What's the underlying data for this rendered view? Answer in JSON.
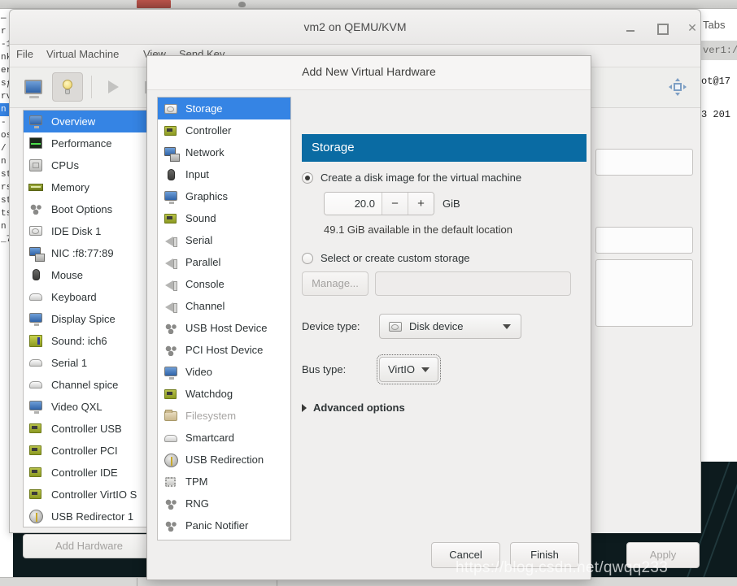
{
  "desktop": {
    "left_terminal_lines": [
      "—",
      "r",
      "-1",
      "nk",
      "er",
      "",
      "sƒ",
      "",
      "rv",
      "n",
      "-",
      "os",
      "/",
      "n",
      "st",
      "rs",
      "st",
      "ts",
      "n",
      "_7"
    ],
    "left_selected_index": 9,
    "right_terminal": {
      "tabs_label": "Tabs",
      "tab_title": "ver1:/..",
      "prompt_line": "ot@17",
      "date_line": "3 201"
    },
    "watermark": "https://blog.csdn.net/qwqq233"
  },
  "vm_window": {
    "title": "vm2 on QEMU/KVM",
    "window_buttons": {
      "minimize": "minimize-icon",
      "maximize": "maximize-icon",
      "close": "✕"
    },
    "menu": [
      "File",
      "Virtual Machine",
      "View",
      "Send Key"
    ],
    "toolbar": [
      {
        "name": "show-console-button",
        "icon": "monitor-icon"
      },
      {
        "name": "show-hardware-details-button",
        "icon": "lightbulb-icon",
        "active": true
      },
      {
        "name": "run-button",
        "icon": "play-icon"
      },
      {
        "name": "pause-button",
        "icon": "pause-icon"
      },
      {
        "name": "fullscreen-button",
        "icon": "fullscreen-icon"
      }
    ],
    "hardware_items": [
      {
        "label": "Overview",
        "icon": "monitor-icon",
        "selected": true
      },
      {
        "label": "Performance",
        "icon": "performance-graph-icon"
      },
      {
        "label": "CPUs",
        "icon": "cpu-icon"
      },
      {
        "label": "Memory",
        "icon": "memory-stick-icon"
      },
      {
        "label": "Boot Options",
        "icon": "gears-icon"
      },
      {
        "label": "IDE Disk 1",
        "icon": "disk-icon"
      },
      {
        "label": "NIC :f8:77:89",
        "icon": "network-icon"
      },
      {
        "label": "Mouse",
        "icon": "mouse-icon"
      },
      {
        "label": "Keyboard",
        "icon": "keyboard-icon"
      },
      {
        "label": "Display Spice",
        "icon": "display-icon"
      },
      {
        "label": "Sound: ich6",
        "icon": "sound-icon"
      },
      {
        "label": "Serial 1",
        "icon": "serial-icon"
      },
      {
        "label": "Channel spice",
        "icon": "channel-icon"
      },
      {
        "label": "Video QXL",
        "icon": "video-icon"
      },
      {
        "label": "Controller USB",
        "icon": "controller-card-icon"
      },
      {
        "label": "Controller PCI",
        "icon": "controller-card-icon"
      },
      {
        "label": "Controller IDE",
        "icon": "controller-card-icon"
      },
      {
        "label": "Controller VirtIO S",
        "icon": "controller-card-icon"
      },
      {
        "label": "USB Redirector 1",
        "icon": "usb-icon"
      }
    ],
    "add_hardware_label": "Add Hardware",
    "apply_label": "Apply"
  },
  "dialog": {
    "title": "Add New Virtual Hardware",
    "categories": [
      {
        "label": "Storage",
        "icon": "disk-icon",
        "selected": true
      },
      {
        "label": "Controller",
        "icon": "controller-card-icon"
      },
      {
        "label": "Network",
        "icon": "network-icon"
      },
      {
        "label": "Input",
        "icon": "mouse-icon"
      },
      {
        "label": "Graphics",
        "icon": "display-icon"
      },
      {
        "label": "Sound",
        "icon": "sound-card-icon"
      },
      {
        "label": "Serial",
        "icon": "speaker-icon"
      },
      {
        "label": "Parallel",
        "icon": "speaker-icon"
      },
      {
        "label": "Console",
        "icon": "speaker-icon"
      },
      {
        "label": "Channel",
        "icon": "speaker-icon"
      },
      {
        "label": "USB Host Device",
        "icon": "gears-icon"
      },
      {
        "label": "PCI Host Device",
        "icon": "gears-icon"
      },
      {
        "label": "Video",
        "icon": "display-icon"
      },
      {
        "label": "Watchdog",
        "icon": "controller-card-icon"
      },
      {
        "label": "Filesystem",
        "icon": "folder-icon",
        "disabled": true
      },
      {
        "label": "Smartcard",
        "icon": "smartcard-icon"
      },
      {
        "label": "USB Redirection",
        "icon": "usb-icon"
      },
      {
        "label": "TPM",
        "icon": "chip-icon"
      },
      {
        "label": "RNG",
        "icon": "gears-icon"
      },
      {
        "label": "Panic Notifier",
        "icon": "gears-icon"
      }
    ],
    "panel": {
      "header": "Storage",
      "create_disk": {
        "label": "Create a disk image for the virtual machine",
        "selected": true,
        "size_value": "20.0",
        "minus": "−",
        "plus": "+",
        "unit": "GiB",
        "available_note": "49.1 GiB available in the default location"
      },
      "custom_storage": {
        "label": "Select or create custom storage",
        "selected": false,
        "manage_label": "Manage...",
        "path_value": "",
        "path_placeholder": ""
      },
      "device_type": {
        "label": "Device type:",
        "value": "Disk device",
        "icon": "disk-icon"
      },
      "bus_type": {
        "label": "Bus type:",
        "value": "VirtIO",
        "focused": true
      },
      "advanced_options": "Advanced options"
    },
    "buttons": {
      "cancel": "Cancel",
      "finish": "Finish"
    }
  },
  "colors": {
    "selection_blue": "#3584e4",
    "header_blue": "#0a6ba3",
    "window_bg": "#f0efee",
    "list_bg": "#ffffff"
  }
}
